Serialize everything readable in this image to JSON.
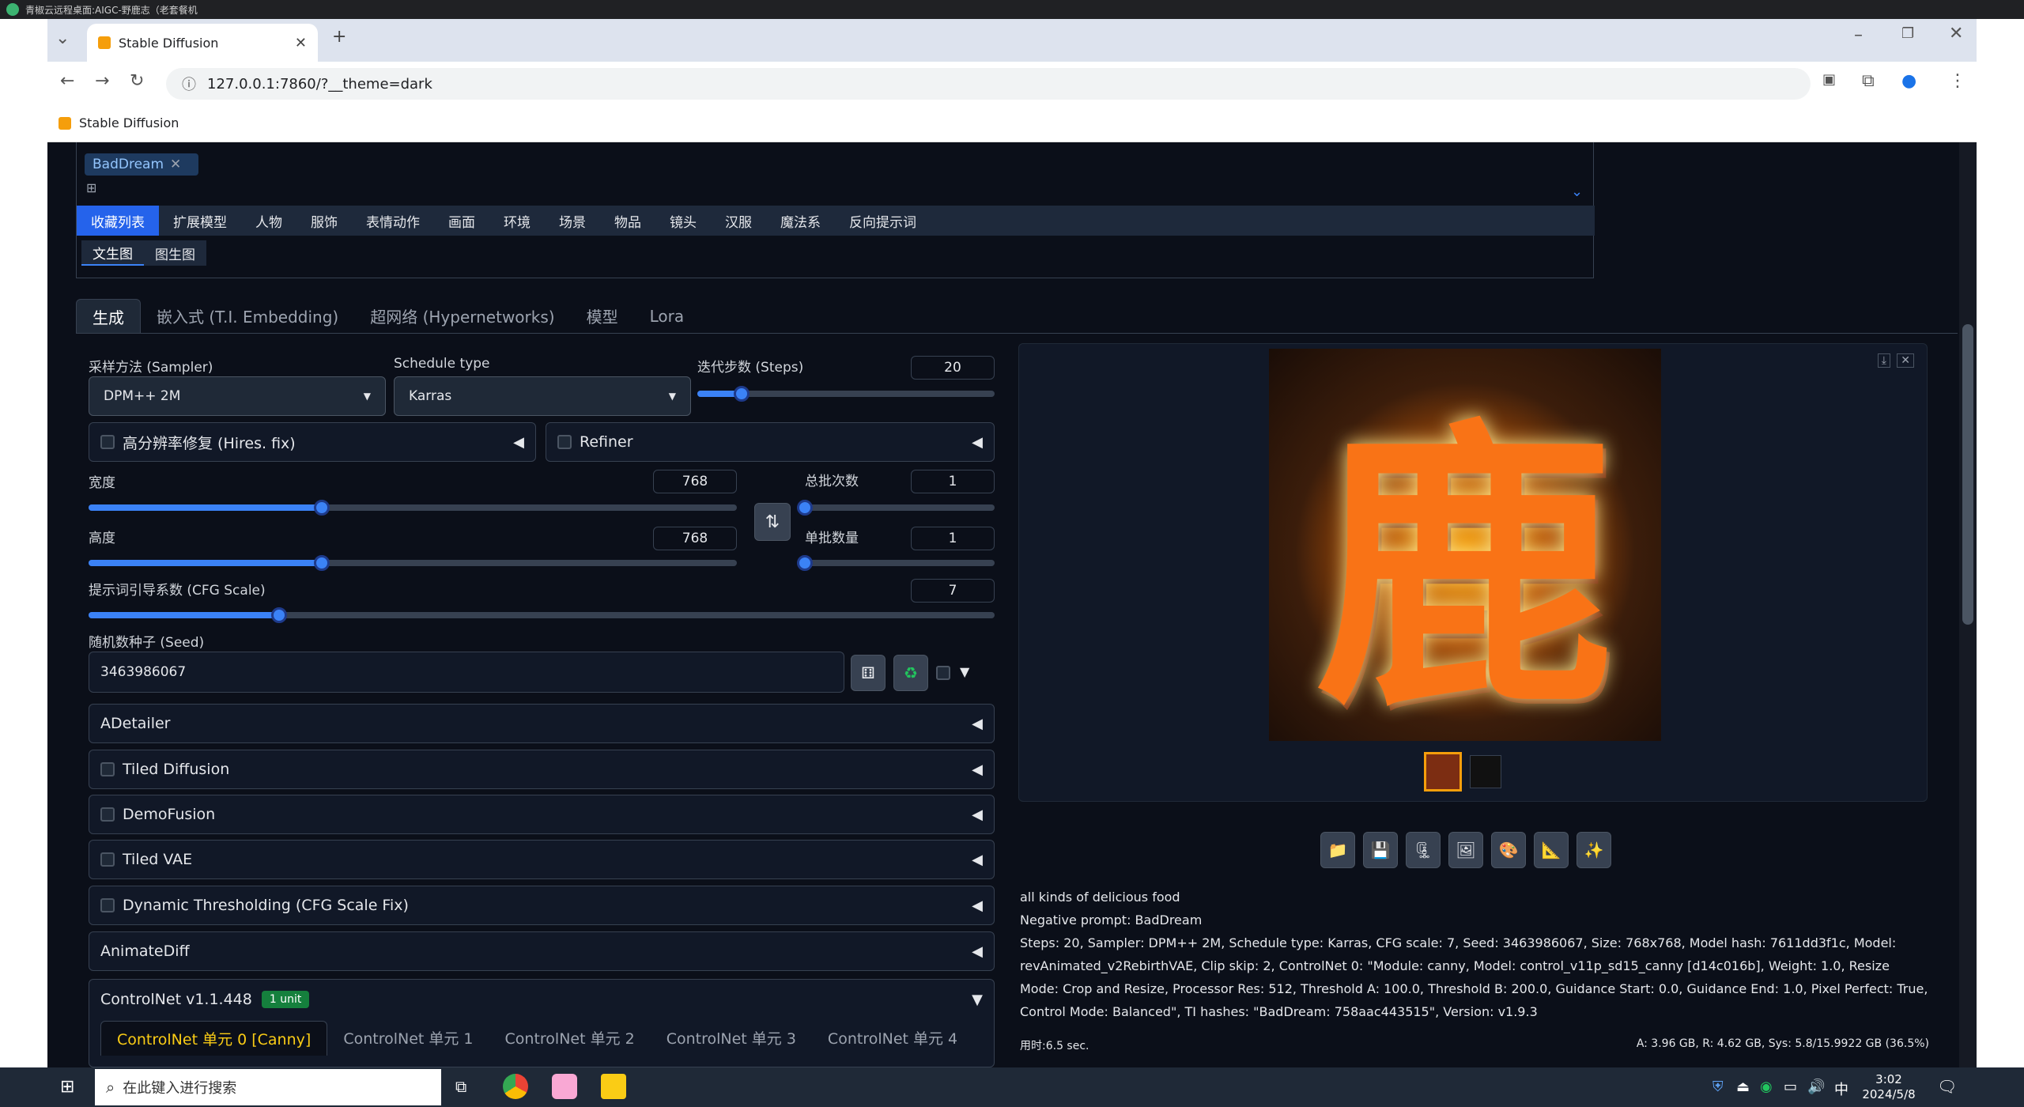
{
  "remote_title": "青椒云远程桌面:AIGC-野鹿志（老套餐机",
  "browser": {
    "tab_title": "Stable Diffusion",
    "url": "127.0.0.1:7860/?__theme=dark",
    "bookmark": "Stable Diffusion"
  },
  "tag": {
    "text": "BadDream"
  },
  "prompt_tabs": [
    "收藏列表",
    "扩展模型",
    "人物",
    "服饰",
    "表情动作",
    "画面",
    "环境",
    "场景",
    "物品",
    "镜头",
    "汉服",
    "魔法系",
    "反向提示词"
  ],
  "subtabs": [
    "文生图",
    "图生图"
  ],
  "main_tabs": [
    "生成",
    "嵌入式 (T.I. Embedding)",
    "超网络 (Hypernetworks)",
    "模型",
    "Lora"
  ],
  "sampler": {
    "label": "采样方法 (Sampler)",
    "value": "DPM++ 2M"
  },
  "schedule": {
    "label": "Schedule type",
    "value": "Karras"
  },
  "steps": {
    "label": "迭代步数 (Steps)",
    "value": "20",
    "fraction": 0.15
  },
  "hires": {
    "label": "高分辨率修复 (Hires. fix)"
  },
  "refiner": {
    "label": "Refiner"
  },
  "width": {
    "label": "宽度",
    "value": "768",
    "fraction": 0.36
  },
  "height": {
    "label": "高度",
    "value": "768",
    "fraction": 0.36
  },
  "batch_count": {
    "label": "总批次数",
    "value": "1",
    "fraction": 0.0
  },
  "batch_size": {
    "label": "单批数量",
    "value": "1",
    "fraction": 0.0
  },
  "cfg": {
    "label": "提示词引导系数 (CFG Scale)",
    "value": "7",
    "fraction": 0.21
  },
  "seed": {
    "label": "随机数种子 (Seed)",
    "value": "3463986067"
  },
  "accordions": [
    {
      "label": "ADetailer",
      "checkbox": false
    },
    {
      "label": "Tiled Diffusion",
      "checkbox": true
    },
    {
      "label": "DemoFusion",
      "checkbox": true
    },
    {
      "label": "Tiled VAE",
      "checkbox": true
    },
    {
      "label": "Dynamic Thresholding (CFG Scale Fix)",
      "checkbox": true
    },
    {
      "label": "AnimateDiff",
      "checkbox": false
    }
  ],
  "controlnet": {
    "label": "ControlNet v1.1.448",
    "badge": "1 unit",
    "units": [
      "ControlNet 单元 0 [Canny]",
      "ControlNet 单元 1",
      "ControlNet 单元 2",
      "ControlNet 单元 3",
      "ControlNet 单元 4"
    ]
  },
  "output": {
    "prompt": "all kinds of delicious food",
    "negative": "Negative prompt: BadDream",
    "params": "Steps: 20, Sampler: DPM++ 2M, Schedule type: Karras, CFG scale: 7, Seed: 3463986067, Size: 768x768, Model hash: 7611dd3f1c, Model: revAnimated_v2RebirthVAE, Clip skip: 2, ControlNet 0: \"Module: canny, Model: control_v11p_sd15_canny [d14c016b], Weight: 1.0, Resize Mode: Crop and Resize, Processor Res: 512, Threshold A: 100.0, Threshold B: 200.0, Guidance Start: 0.0, Guidance End: 1.0, Pixel Perfect: True, Control Mode: Balanced\", TI hashes: \"BadDream: 758aac443515\", Version: v1.9.3",
    "time": "用时:6.5 sec.",
    "memory": "A: 3.96 GB, R: 4.62 GB, Sys: 5.8/15.9922 GB (36.5%)",
    "image_char": "鹿"
  },
  "taskbar": {
    "search_placeholder": "在此键入进行搜索",
    "ime": "中",
    "time": "3:02",
    "date": "2024/5/8"
  },
  "colors": {
    "accent": "#3b82f6",
    "orange": "#f59e0b",
    "bg": "#0b0f19",
    "panel": "#1f2937"
  }
}
